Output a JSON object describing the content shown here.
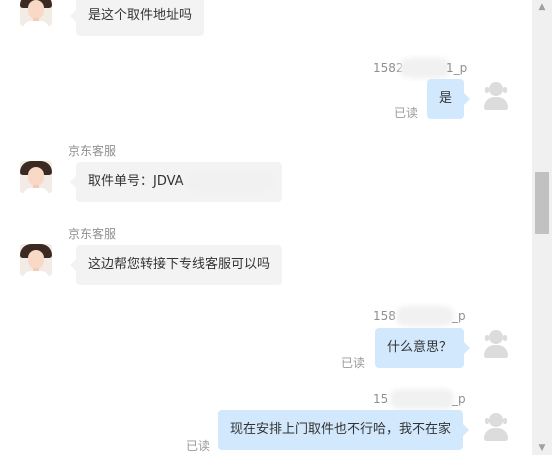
{
  "messages": {
    "m1": {
      "text": "是这个取件地址吗"
    },
    "m2": {
      "sender_prefix": "1582",
      "sender_suffix": "1_p",
      "text": "是",
      "read": "已读"
    },
    "m3": {
      "sender": "京东客服",
      "text": "取件单号：JDVA"
    },
    "m4": {
      "sender": "京东客服",
      "text": "这边帮您转接下专线客服可以吗"
    },
    "m5": {
      "sender_prefix": "158",
      "sender_suffix": "_p",
      "text": "什么意思？",
      "read": "已读"
    },
    "m6": {
      "sender_prefix": "15",
      "sender_suffix": "_p",
      "text": "现在安排上门取件也不行哈，我不在家",
      "read": "已读"
    }
  },
  "icons": {
    "agent_avatar": "agent-avatar",
    "user_avatar": "user-headset-icon",
    "scroll_up": "scroll-up-arrow",
    "scroll_down": "scroll-down-arrow"
  }
}
